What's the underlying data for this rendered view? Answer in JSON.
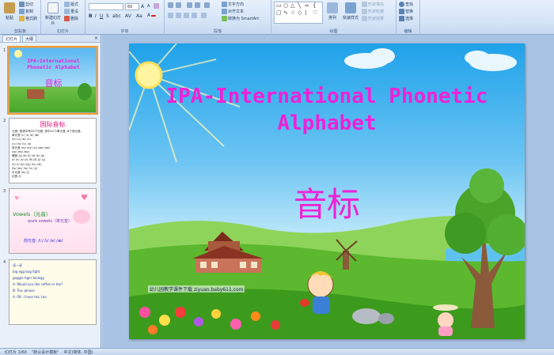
{
  "ribbon": {
    "clipboard": {
      "paste": "粘贴",
      "cut": "剪切",
      "copy": "复制",
      "format_painter": "格式刷",
      "label": "剪贴板"
    },
    "slides": {
      "new_slide": "新建幻灯片",
      "layout": "版式",
      "reset": "重设",
      "delete": "删除",
      "label": "幻灯片"
    },
    "font": {
      "font_name": "",
      "font_size": "60",
      "label": "字体"
    },
    "paragraph": {
      "text_direction": "文字方向",
      "align_text": "对齐文本",
      "smartart": "转换为 SmartArt",
      "label": "段落"
    },
    "drawing": {
      "arrange": "排列",
      "quick_styles": "快速样式",
      "shape_fill": "形状填充",
      "shape_outline": "形状轮廓",
      "shape_effects": "形状效果",
      "label": "绘图"
    },
    "editing": {
      "find": "查找",
      "replace": "替换",
      "select": "选择",
      "label": "编辑"
    }
  },
  "panel": {
    "tabs": [
      "幻灯片",
      "大纲"
    ],
    "close": "×"
  },
  "thumbnails": {
    "t1": {
      "num": "1",
      "title": "IPA-International Phonetic Alphabet",
      "sub": "音标"
    },
    "t2": {
      "num": "2",
      "title": "国际音标",
      "lines": [
        "元音: 英语中有20个元音, 其中12个单元音, 8个双元音。",
        "单元音 /i:/ /ɪ/ /e/ /æ/",
        "  /ɑ:/ /ʌ/ /ɒ/ /ɔ:/",
        "  /u:/ /ʊ/ /ɜ:/ /ə/",
        "双元音 /eɪ/ /aɪ/ /ɔɪ/ /əʊ/ /aʊ/",
        "  /ɪə/ /eə/ /ʊə/",
        "辅音 /p/ /b/ /t/ /d/ /k/ /g/",
        "  /f/ /v/ /s/ /z/ /θ/ /ð/ /ʃ/ /ʒ/",
        "  /h/ /r/ /tʃ/ /dʒ/ /tr/ /dr/",
        "  /ts/ /dz/ /m/ /n/ /ŋ/",
        "半元音 /w/ /j/",
        "边音 /l/"
      ]
    },
    "t3": {
      "num": "3",
      "title": "Vowels（元音）",
      "sub": "-pure vowels（单元音）",
      "line": "前元音: /i:/ /ɪ/ /e/ /æ/"
    },
    "t4": {
      "num": "4",
      "lines": [
        "读一读",
        "big   egg   bag   fight",
        "goggle   tiger   biology",
        "A: Would you like coffee or tea?",
        "B: Tea, please.",
        "A: OK. I have tea, too."
      ]
    }
  },
  "slide": {
    "title_line1": "IPA-International Phonetic",
    "title_line2": "Alphabet",
    "subtitle": "音标",
    "watermark": "幼儿园教学课件下载  ziyuan.baby611.com"
  },
  "status": {
    "slide_count": "幻灯片 1/60",
    "theme": "\"默认设计模板\"",
    "language": "中文(简体, 中国)"
  }
}
